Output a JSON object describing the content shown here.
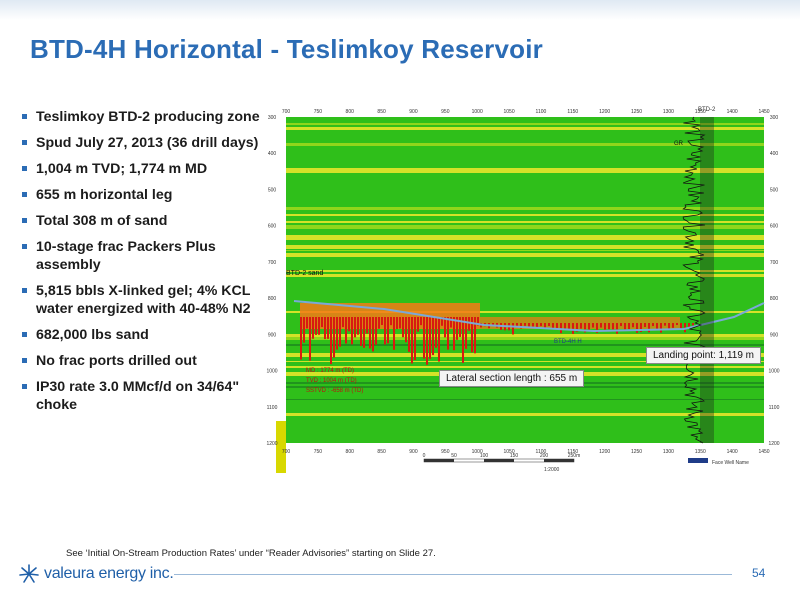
{
  "slide": {
    "title": "BTD-4H Horizontal - Teslimkoy Reservoir",
    "page_number": "54",
    "footnote": "See ‘Initial On-Stream Production Rates’ under “Reader Advisories” starting on Slide 27.",
    "logo_text": "valeura energy inc."
  },
  "bullets": [
    "Teslimkoy BTD-2 producing zone",
    "Spud July 27, 2013 (36 drill days)",
    "1,004 m TVD; 1,774 m MD",
    "655 m horizontal leg",
    "Total 308 m of sand",
    "10-stage frac Packers Plus assembly",
    "5,815 bbls X-linked gel; 4% KCL water energized with 40-48% N2",
    "682,000 lbs sand",
    "No frac ports drilled out",
    "IP30 rate 3.0 MMcf/d on 34/64\" choke"
  ],
  "figure": {
    "x_ticks": [
      "700",
      "750",
      "800",
      "850",
      "900",
      "950",
      "1000",
      "1050",
      "1100",
      "1150",
      "1200",
      "1250",
      "1300",
      "1350",
      "1400",
      "1450"
    ],
    "y_ticks": [
      "300",
      "400",
      "500",
      "600",
      "700",
      "800",
      "900",
      "1000",
      "1100",
      "1200"
    ],
    "well_label": "BTD-2",
    "gr_label": "GR",
    "sand_label": "BTD-2 sand",
    "well_path_label": "BTD-4H H",
    "md_text": "MD : 1774 m (TD)",
    "tvd_text": "TVD : 1004 m (TD)",
    "sstvd_text": "SSTVD : -658 m (TD)",
    "callout_lateral": "Lateral section length : 655  m",
    "callout_landing": "Landing point: 1,119 m",
    "scale_ticks": [
      "0",
      "50",
      "100",
      "150",
      "200",
      "250m"
    ],
    "scale_unit": "1:2000",
    "legend_text": "Face Well Name",
    "colors": {
      "bg_green": "#2fbf1a",
      "band_yellow": "#e7e52a",
      "band_dark": "#1f8f1e",
      "frac_red": "#d81a10",
      "frac_orange": "#f57a16",
      "accent_blue": "#2b6cb5"
    }
  }
}
